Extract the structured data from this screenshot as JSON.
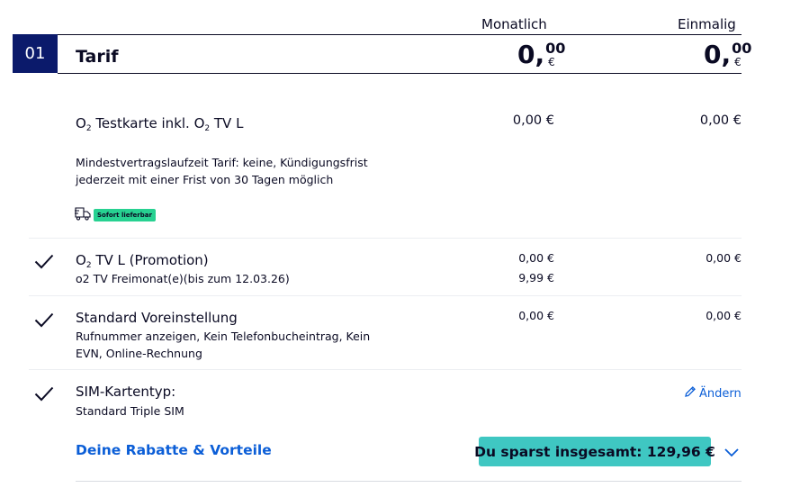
{
  "columns": {
    "monthly": "Monatlich",
    "onetime": "Einmalig"
  },
  "section": {
    "number": "01",
    "title": "Tarif",
    "total_monthly": {
      "main": "0,",
      "cents": "00",
      "currency": "€"
    },
    "total_onetime": {
      "main": "0,",
      "cents": "00",
      "currency": "€"
    }
  },
  "main_item": {
    "name_prefix": "O",
    "name_sub": "2",
    "name_mid": " Testkarte inkl. O",
    "name_sub2": "2",
    "name_suffix": " TV L",
    "monthly": "0,00 €",
    "onetime": "0,00 €",
    "terms_line1": "Mindestvertragslaufzeit Tarif: keine, Kündigungsfrist",
    "terms_line2": "jederzeit mit einer Frist von 30 Tagen möglich",
    "delivery_icon": "truck-icon",
    "delivery_badge": "Sofort lieferbar"
  },
  "options": [
    {
      "name_prefix": "O",
      "name_sub": "2",
      "name_suffix": " TV L (Promotion)",
      "detail": "o2 TV Freimonat(e)(bis zum 12.03.26)",
      "monthly": "0,00 €",
      "monthly_after": "9,99 €",
      "onetime": "0,00 €"
    },
    {
      "name": "Standard Voreinstellung",
      "detail_line1": "Rufnummer anzeigen, Kein Telefonbucheintrag, Kein",
      "detail_line2": "EVN, Online-Rechnung",
      "monthly": "0,00 €",
      "onetime": "0,00 €"
    },
    {
      "name": "SIM-Kartentyp:",
      "detail": "Standard Triple SIM",
      "edit_label": "Ändern",
      "edit_icon": "pencil-icon"
    }
  ],
  "discounts": {
    "link_label": "Deine Rabatte & Vorteile",
    "savings_label": "Du sparst insgesamt: 129,96 €",
    "expand_icon": "chevron-down-icon",
    "accent_color": "#3fc7c2"
  }
}
